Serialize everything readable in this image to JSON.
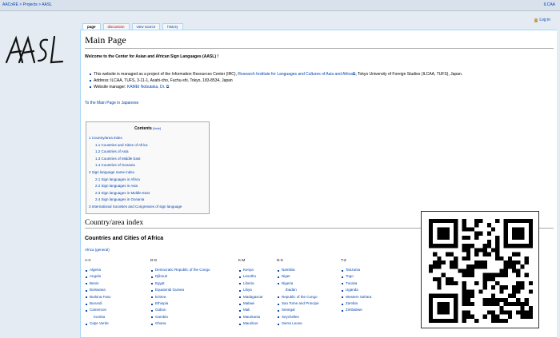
{
  "topbar": {
    "breadcrumb": "AACoRE > Projects > AASL",
    "org_link": "ILCAA"
  },
  "login": {
    "label": "Log in",
    "icon": "user-icon"
  },
  "logo": {
    "text": "AASL"
  },
  "tabs": [
    {
      "label": "page",
      "active": true
    },
    {
      "label": "discussion",
      "active": false
    },
    {
      "label": "view source",
      "active": false
    },
    {
      "label": "history",
      "active": false
    }
  ],
  "page": {
    "title": "Main Page",
    "welcome": "Welcome to the Center for Asian and African Sign Languages (AASL) !",
    "bullets": [
      {
        "prefix": "This website is managed as a project of the Information Resources Center (IRC), ",
        "link": "Research Institute for Languages and Cultures of Asia and Africa",
        "suffix": ", Tokyo University of Foreign Studies (ILCAA, TUFS), Japan."
      },
      {
        "prefix": "Address: ILCAA, TUFS, 3-11-1, Asahi-cho, Fuchu-shi, Tokyo, 183-8534, Japan",
        "link": "",
        "suffix": ""
      },
      {
        "prefix": "Website manager: ",
        "link": "KAMEI Nobutaka, Dr.",
        "suffix": ""
      }
    ],
    "japanese_link": "To the Main Page in Japanese"
  },
  "toc": {
    "title": "Contents",
    "hide": "[hide]",
    "items": [
      {
        "label": "1 Country/area index",
        "level": 1
      },
      {
        "label": "1.1 Countries and Cities of Africa",
        "level": 2
      },
      {
        "label": "1.2 Countries of Asia",
        "level": 2
      },
      {
        "label": "1.3 Countries of Middle East",
        "level": 2
      },
      {
        "label": "1.4 Countries of Oceania",
        "level": 2
      },
      {
        "label": "2 Sign language name index",
        "level": 1
      },
      {
        "label": "2.1 Sign languages in Africa",
        "level": 2
      },
      {
        "label": "2.2 Sign languages in Asia",
        "level": 2
      },
      {
        "label": "2.3 Sign languages in Middle East",
        "level": 2
      },
      {
        "label": "2.4 Sign languages in Oceania",
        "level": 2
      },
      {
        "label": "3 International Societies and Congresses of sign language",
        "level": 1
      }
    ]
  },
  "section": {
    "heading": "Country/area index",
    "subheading": "Countries and Cities of Africa",
    "general_link": "Africa (general)",
    "columns": [
      {
        "head": "A-C",
        "items": [
          "Algeria",
          "Angola",
          "Benin",
          "Botswana",
          "Burkina Faso",
          "Burundi",
          "Cameroon",
          "~Kumba",
          "Cape Verde"
        ]
      },
      {
        "head": "D-G",
        "items": [
          "Democratic Republic of the Congo",
          "Djibouti",
          "Egypt",
          "Equatorial Guinea",
          "Eritrea",
          "Ethiopia",
          "Gabon",
          "Gambia",
          "Ghana"
        ]
      },
      {
        "head": "K-M",
        "items": [
          "Kenya",
          "Lesotho",
          "Liberia",
          "Libya",
          "Madagascar",
          "Malawi",
          "Mali",
          "Mauritania",
          "Mauritius"
        ]
      },
      {
        "head": "N-S",
        "items": [
          "Namibia",
          "Niger",
          "Nigeria",
          "~Ibadan",
          "Republic of the Congo",
          "Sao Tome and Principe",
          "Senegal",
          "Seychelles",
          "Sierra Leone"
        ]
      },
      {
        "head": "T-Z",
        "items": [
          "Tanzania",
          "Togo",
          "Tunisia",
          "Uganda",
          "Western Sahara",
          "Zambia",
          "Zimbabwe"
        ]
      }
    ]
  }
}
